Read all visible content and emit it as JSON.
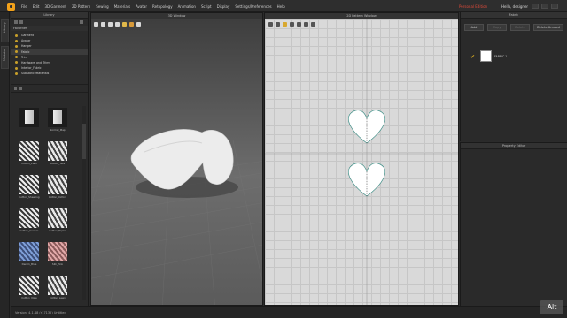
{
  "menu": {
    "items": [
      "File",
      "Edit",
      "3D Garment",
      "2D Pattern",
      "Sewing",
      "Materials",
      "Avatar",
      "Retopology",
      "Animation",
      "Script",
      "Display",
      "Settings/Preferences",
      "Help"
    ],
    "trial_text": "Personal Edition",
    "user_text": "Hello, designer"
  },
  "left_tabs": [
    "Library",
    "Modular"
  ],
  "library": {
    "title": "Library",
    "favorites_label": "Favorites",
    "tree": [
      "Garment",
      "Avatar",
      "Hanger",
      "Fabric",
      "Trim",
      "Hardware_and_Trims",
      "Interior_Fabric",
      "SubstanceMaterials"
    ],
    "selected_index": 3,
    "thumbs": [
      {
        "caption": "",
        "style": "folder"
      },
      {
        "caption": "Normal_Map",
        "style": "folder"
      },
      {
        "caption": "Cotton_Plain",
        "style": "stripe"
      },
      {
        "caption": "Cotton_Twill",
        "style": "stripe2"
      },
      {
        "caption": "Cotton_Sheeting",
        "style": "stripe"
      },
      {
        "caption": "Cotton_Oxford",
        "style": "stripe2"
      },
      {
        "caption": "Cotton_Canvas",
        "style": "stripe"
      },
      {
        "caption": "Cotton_Poplin",
        "style": "stripe2"
      },
      {
        "caption": "Denim_Blue",
        "style": "blue"
      },
      {
        "caption": "Silk_Pink",
        "style": "pink"
      },
      {
        "caption": "Cotton_Voile",
        "style": "stripe"
      },
      {
        "caption": "Cotton_Lawn",
        "style": "stripe2"
      }
    ]
  },
  "window3d": {
    "title": "3D Window"
  },
  "window2d": {
    "title": "2D Pattern Window"
  },
  "fabric_panel": {
    "title": "Fabric",
    "buttons": [
      "Add",
      "Copy",
      "Delete",
      "Delete Unused"
    ],
    "items": [
      {
        "name": "FABRIC 1",
        "color": "#ffffff"
      }
    ]
  },
  "property_panel": {
    "title": "Property Editor"
  },
  "status": {
    "text": "Version: 4.1.48 (r17132)   Untitled"
  },
  "watermark": "Alt"
}
